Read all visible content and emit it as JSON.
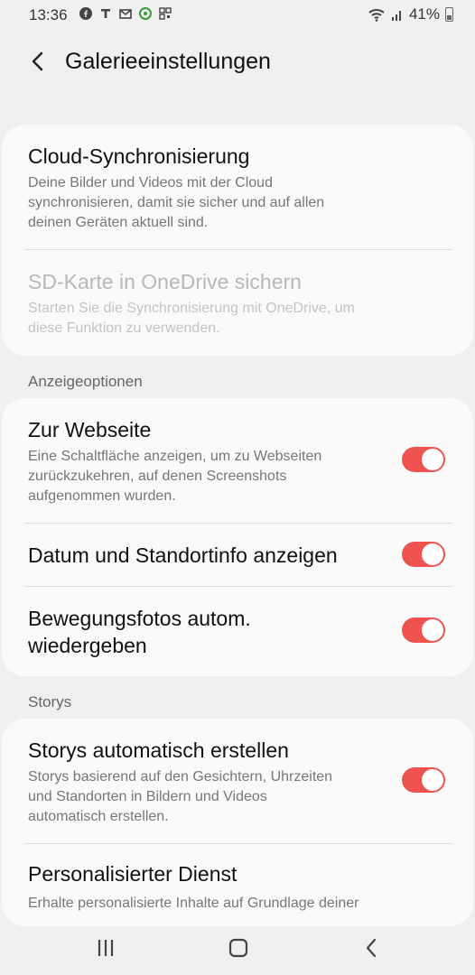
{
  "status": {
    "time": "13:36",
    "battery": "41%"
  },
  "header": {
    "title": "Galerieeinstellungen"
  },
  "cloud": {
    "sync_title": "Cloud-Synchronisierung",
    "sync_sub_1": "Deine Bilder und Videos mit der Cloud",
    "sync_sub_2": "synchronisieren, damit sie sicher und auf allen",
    "sync_sub_3": "deinen Geräten aktuell sind.",
    "sd_title": "SD-Karte in OneDrive sichern",
    "sd_sub_1": "Starten Sie die Synchronisierung mit OneDrive, um",
    "sd_sub_2": "diese Funktion zu verwenden."
  },
  "display": {
    "label": "Anzeigeoptionen",
    "web_title": "Zur Webseite",
    "web_sub_1": "Eine Schaltfläche anzeigen, um zu Webseiten",
    "web_sub_2": "zurückzukehren, auf denen Screenshots",
    "web_sub_3": "aufgenommen wurden.",
    "date_title": "Datum und Standortinfo anzeigen",
    "motion_title_1": "Bewegungsfotos autom.",
    "motion_title_2": "wiedergeben"
  },
  "stories": {
    "label": "Storys",
    "auto_title": "Storys automatisch erstellen",
    "auto_sub_1": "Storys basierend auf den Gesichtern, Uhrzeiten",
    "auto_sub_2": "und Standorten in Bildern und Videos",
    "auto_sub_3": "automatisch erstellen.",
    "personal_title": "Personalisierter Dienst",
    "personal_sub_1": "Erhalte personalisierte Inhalte auf Grundlage deiner"
  },
  "toggles": {
    "web": true,
    "date": true,
    "motion": true,
    "stories": true
  },
  "colors": {
    "accent": "#ef5350",
    "background": "#f0f0f0",
    "card": "#fafafa"
  },
  "icons": [
    "facebook-icon",
    "telekom-icon",
    "mail-icon",
    "app-icon",
    "qr-icon",
    "wifi-icon",
    "signal-icon",
    "battery-icon",
    "back-arrow-icon",
    "recents-icon",
    "home-icon",
    "back-nav-icon"
  ]
}
